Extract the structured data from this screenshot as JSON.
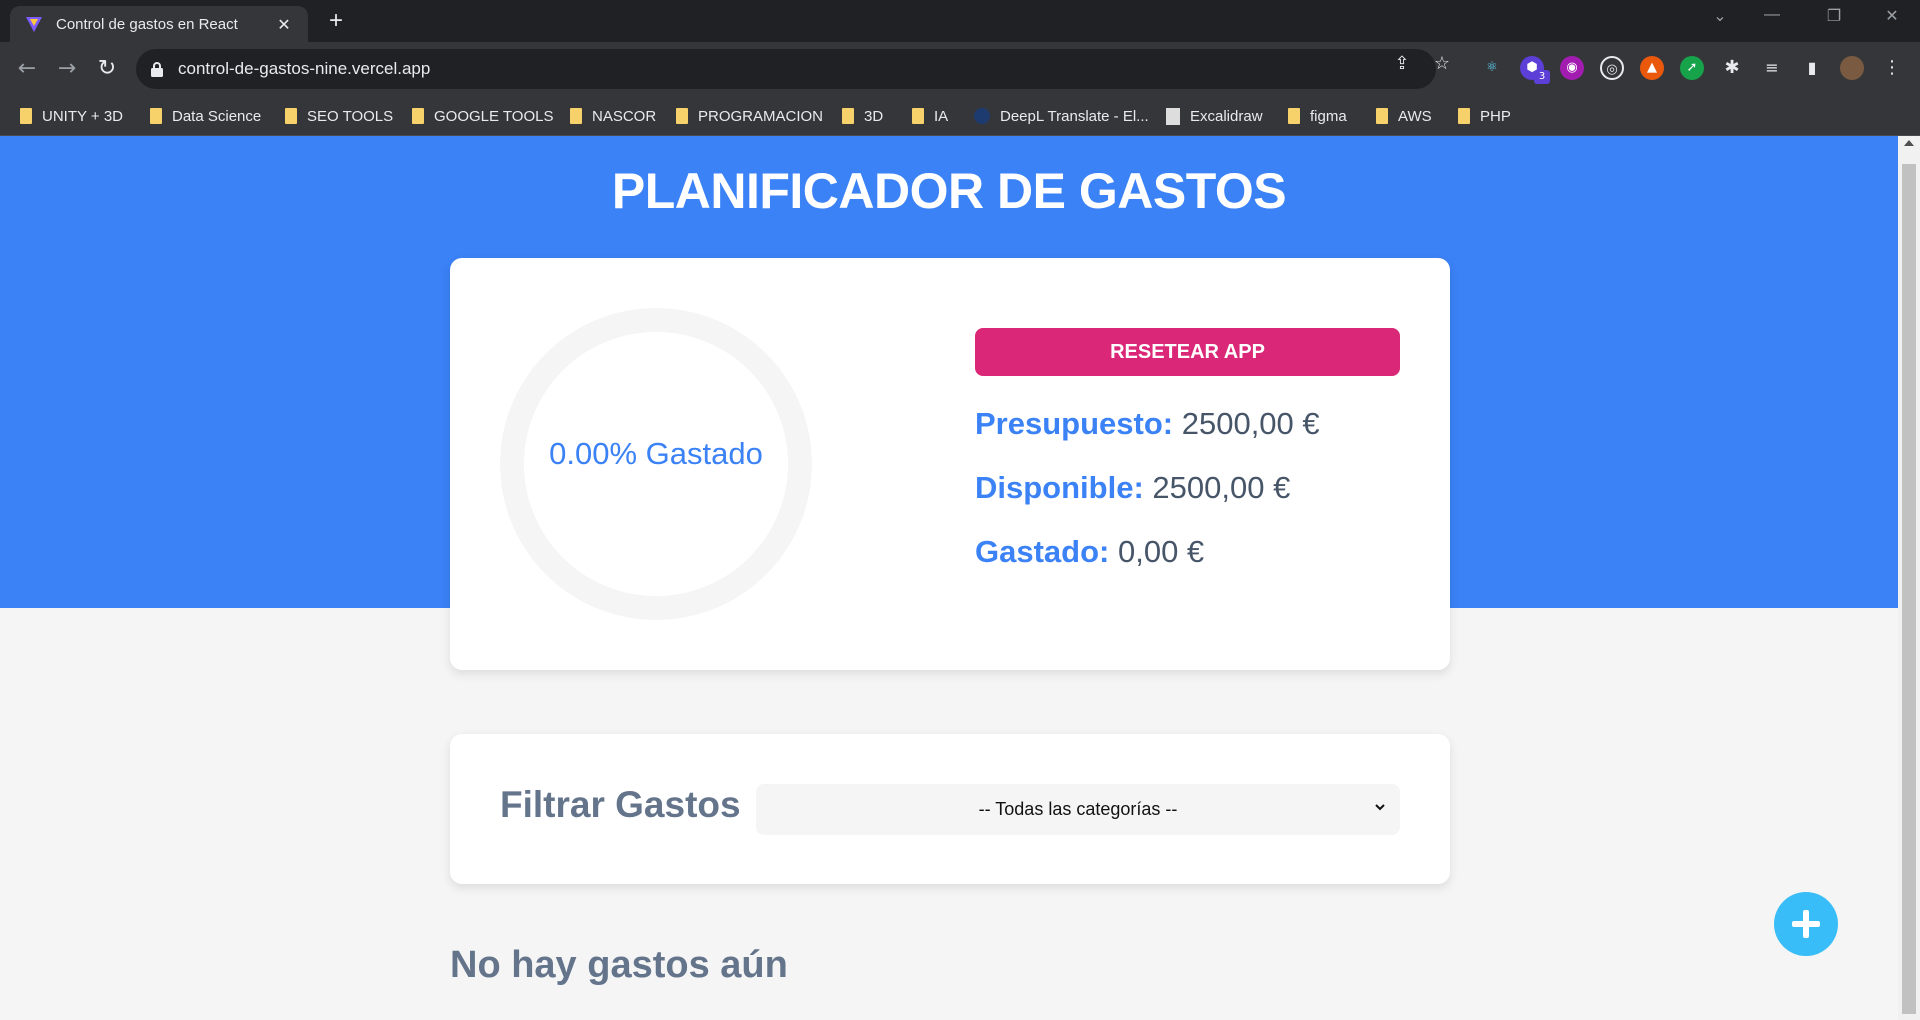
{
  "browser": {
    "tab_title": "Control de gastos en React",
    "url": "control-de-gastos-nine.vercel.app",
    "extension_badge": "3",
    "bookmarks": [
      {
        "label": "UNITY + 3D",
        "icon": "folder-icon"
      },
      {
        "label": "Data Science",
        "icon": "folder-icon"
      },
      {
        "label": "SEO TOOLS",
        "icon": "folder-icon"
      },
      {
        "label": "GOOGLE TOOLS",
        "icon": "folder-icon"
      },
      {
        "label": "NASCOR",
        "icon": "folder-icon"
      },
      {
        "label": "PROGRAMACION",
        "icon": "folder-icon"
      },
      {
        "label": "3D",
        "icon": "folder-icon"
      },
      {
        "label": "IA",
        "icon": "folder-icon"
      },
      {
        "label": "DeepL Translate - El...",
        "icon": "deepl-icon"
      },
      {
        "label": "Excalidraw",
        "icon": "page-icon"
      },
      {
        "label": "figma",
        "icon": "folder-icon"
      },
      {
        "label": "AWS",
        "icon": "folder-icon"
      },
      {
        "label": "PHP",
        "icon": "folder-icon"
      }
    ]
  },
  "app": {
    "title": "PLANIFICADOR DE GASTOS",
    "progress": {
      "percent_spent": 0.0,
      "label": "0.00% Gastado"
    },
    "reset_label": "RESETEAR APP",
    "stats": {
      "budget_label": "Presupuesto:",
      "budget_value": "2500,00 €",
      "available_label": "Disponible:",
      "available_value": "2500,00 €",
      "spent_label": "Gastado:",
      "spent_value": "0,00 €"
    },
    "filter": {
      "label": "Filtrar Gastos",
      "selected_option": "-- Todas las categorías --"
    },
    "empty_message": "No hay gastos aún"
  },
  "colors": {
    "hero_blue": "#3b82f6",
    "reset_pink": "#db2777",
    "fab_blue": "#38bdf8",
    "ring_track": "#f5f5f5"
  }
}
